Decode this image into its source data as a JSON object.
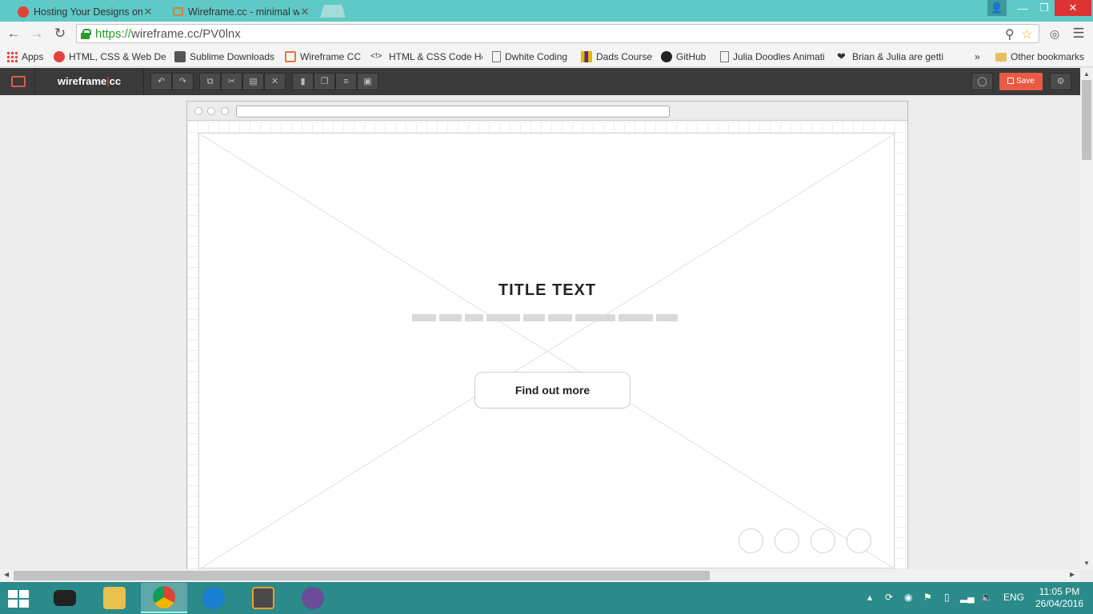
{
  "browser": {
    "tabs": [
      {
        "title": "Hosting Your Designs on",
        "favicon_color": "#e0433c"
      },
      {
        "title": "Wireframe.cc - minimal w",
        "favicon_color": "#e07a35"
      }
    ],
    "url_scheme": "https://",
    "url_rest": "wireframe.cc/PV0lnx",
    "bookmarks": [
      {
        "label": "Apps",
        "icon": "apps-grid-icon"
      },
      {
        "label": "HTML, CSS & Web De",
        "icon": "ga-icon"
      },
      {
        "label": "Sublime Downloads",
        "icon": "sublime-icon"
      },
      {
        "label": "Wireframe CC",
        "icon": "wireframe-icon"
      },
      {
        "label": "HTML & CSS Code He",
        "icon": "code-icon"
      },
      {
        "label": "Dwhite Coding",
        "icon": "page-icon"
      },
      {
        "label": "Dads Course",
        "icon": "course-icon"
      },
      {
        "label": "GitHub",
        "icon": "github-icon"
      },
      {
        "label": "Julia Doodles Animati",
        "icon": "page-icon"
      },
      {
        "label": "Brian & Julia are getti",
        "icon": "heart-icon"
      }
    ],
    "overflow_label": "»",
    "other_bookmarks": "Other bookmarks"
  },
  "app": {
    "logo": "wireframe|cc",
    "save_label": "Save"
  },
  "wireframe": {
    "title": "TITLE TEXT",
    "button_label": "Find out more"
  },
  "taskbar": {
    "time": "11:05 PM",
    "date": "26/04/2016",
    "lang": "ENG"
  },
  "colors": {
    "accent": "#e85a44",
    "chrome_teal": "#5ec9c7",
    "taskbar": "#2b8a8a"
  }
}
